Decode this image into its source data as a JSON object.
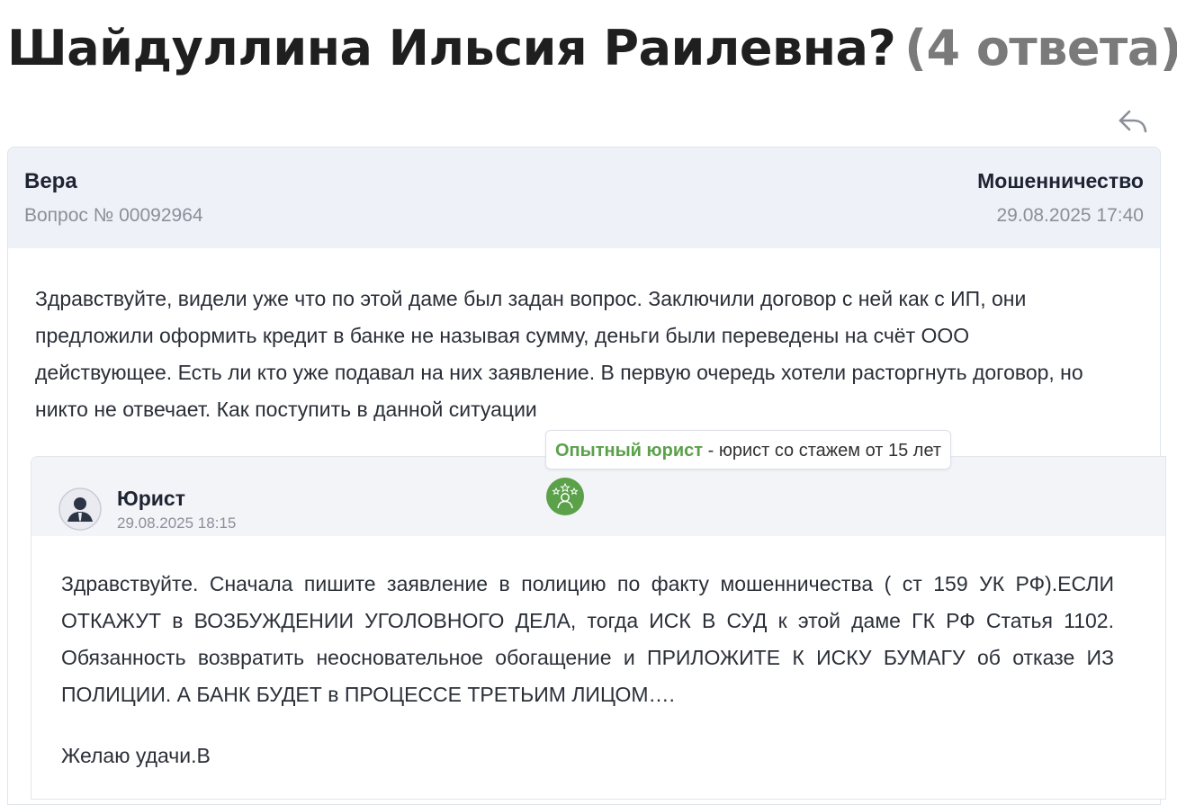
{
  "page": {
    "title": "Шайдуллина Ильсия Раилевна?",
    "answer_count": "(4 ответа)",
    "reply_icon": "reply-arrow-icon"
  },
  "question": {
    "author": "Вера",
    "number": "Вопрос № 00092964",
    "category": "Мошенничество",
    "date": "29.08.2025 17:40",
    "text": "Здравствуйте, видели уже что по этой даме был задан вопрос. Заключили договор с ней как с ИП, они предложили оформить кредит в банке не называя сумму, деньги были переведены на счёт ООО действующее. Есть ли кто уже подавал на них заявление. В первую очередь хотели расторгнуть договор, но никто не отвечает. Как поступить в данной ситуации"
  },
  "tooltip": {
    "title": "Опытный юрист",
    "description": " - юрист со стажем от 15 лет"
  },
  "answer": {
    "author": "Юрист",
    "date": "29.08.2025 18:15",
    "avatar_icon": "user-avatar-icon",
    "badge_icon": "experienced-lawyer-badge-icon",
    "text": "Здравствуйте. Сначала пишите заявление в полицию по факту мошенничества ( ст 159 УК РФ).ЕСЛИ ОТКАЖУТ в ВОЗБУЖДЕНИИ УГОЛОВНОГО ДЕЛА, тогда ИСК В СУД к этой даме ГК РФ Статья 1102. Обязанность возвратить неосновательное обогащение и ПРИЛОЖИТЕ К ИСКУ БУМАГУ об отказе ИЗ ПОЛИЦИИ. А БАНК БУДЕТ в ПРОЦЕССЕ ТРЕТЬИМ ЛИЦОМ….",
    "signoff": "Желаю удачи.В"
  },
  "colors": {
    "header_bg": "#eef1f8",
    "answer_header_bg": "#f3f4f8",
    "badge_green": "#5aa14a",
    "muted_text": "#8a8f99"
  }
}
